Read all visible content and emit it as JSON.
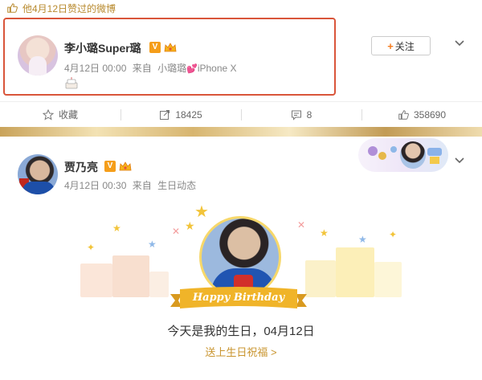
{
  "post1": {
    "liked_text": "他4月12日赞过的微博",
    "user_name": "李小璐Super璐",
    "verified_badge": "V",
    "timestamp": "4月12日 00:00",
    "source_prefix": "来自",
    "source_name": "小璐璐",
    "source_device": "iPhone X",
    "follow_label": "关注",
    "follow_plus": "+",
    "actions": {
      "favorite": "收藏",
      "repost": "18425",
      "comment": "8",
      "like": "358690"
    }
  },
  "post2": {
    "user_name": "贾乃亮",
    "verified_badge": "V",
    "timestamp": "4月12日 00:30",
    "source_prefix": "来自",
    "source_name": "生日动态",
    "ribbon_text": "Happy Birthday",
    "message": "今天是我的生日，04月12日",
    "link_text": "送上生日祝福 >"
  },
  "colors": {
    "accent_orange": "#f57c1f",
    "highlight_red": "#d9553a",
    "gold": "#c9952f",
    "badge": "#f59e1a"
  }
}
